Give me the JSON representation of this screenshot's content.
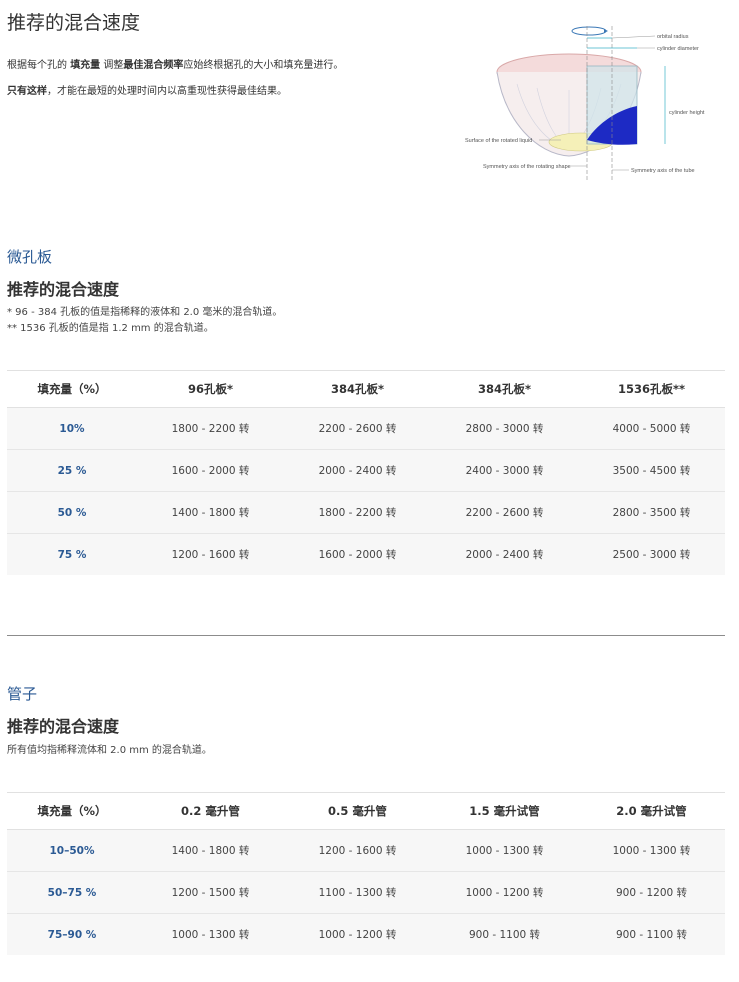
{
  "intro": {
    "title": "推荐的混合速度",
    "p1_pre": "根据每个孔的 ",
    "p1_b1": "填充量",
    "p1_mid": " 调整",
    "p1_b2": "最佳混合频率",
    "p1_post": "应始终根据孔的大小和填充量进行。",
    "p2_b": "只有这样",
    "p2_post": "，才能在最短的处理时间内以高重现性获得最佳结果。"
  },
  "diagram": {
    "orbital_radius": "orbital radius",
    "cylinder_diameter": "cylinder diameter",
    "cylinder_height": "cylinder height",
    "surface_liquid": "Surface of the rotated liquid",
    "symmetry_shape": "Symmetry axis of the rotating shape",
    "symmetry_tube": "Symmetry axis of the tube"
  },
  "plates": {
    "section_title": "微孔板",
    "subtitle": "推荐的混合速度",
    "note1": "* 96 - 384 孔板的值是指稀释的液体和 2.0 毫米的混合轨道。",
    "note2": "** 1536 孔板的值是指 1.2 mm 的混合轨道。",
    "headers": [
      "填充量（%）",
      "96孔板*",
      "384孔板*",
      "384孔板*",
      "1536孔板**"
    ],
    "rows": [
      [
        "10%",
        "1800 - 2200 转",
        "2200 - 2600 转",
        "2800 - 3000 转",
        "4000 - 5000 转"
      ],
      [
        "25 %",
        "1600 - 2000 转",
        "2000 - 2400 转",
        "2400 - 3000 转",
        "3500 - 4500 转"
      ],
      [
        "50 %",
        "1400 - 1800 转",
        "1800 - 2200 转",
        "2200 - 2600 转",
        "2800 - 3500 转"
      ],
      [
        "75 %",
        "1200 - 1600 转",
        "1600 - 2000 转",
        "2000 - 2400 转",
        "2500 - 3000 转"
      ]
    ]
  },
  "tubes": {
    "section_title": "管子",
    "subtitle": "推荐的混合速度",
    "note": "所有值均指稀释流体和 2.0 mm 的混合轨道。",
    "headers": [
      "填充量（%）",
      "0.2 毫升管",
      "0.5 毫升管",
      "1.5 毫升试管",
      "2.0 毫升试管"
    ],
    "rows": [
      [
        "10–50%",
        "1400 - 1800 转",
        "1200 - 1600 转",
        "1000 - 1300 转",
        "1000 - 1300 转"
      ],
      [
        "50–75 %",
        "1200 - 1500 转",
        "1100 - 1300 转",
        "1000 - 1200 转",
        "900 - 1200 转"
      ],
      [
        "75–90 %",
        "1000 - 1300 转",
        "1000 - 1200 转",
        "900 - 1100 转",
        "900 - 1100 转"
      ]
    ]
  }
}
